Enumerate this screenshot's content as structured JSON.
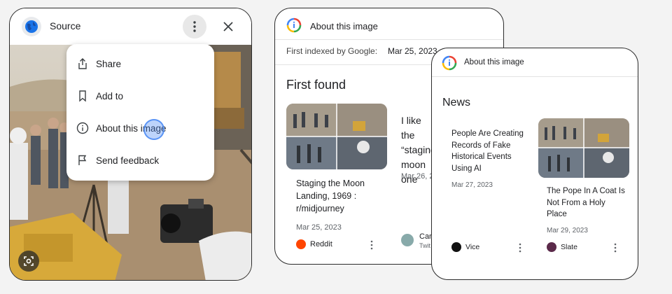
{
  "source_panel": {
    "title": "Source",
    "menu": {
      "items": [
        {
          "label": "Share",
          "icon": "share-icon"
        },
        {
          "label": "Add to",
          "icon": "bookmark-icon"
        },
        {
          "label": "About this image",
          "icon": "info-icon"
        },
        {
          "label": "Send feedback",
          "icon": "flag-icon"
        }
      ]
    },
    "icons": {
      "site": "globe-icon",
      "more": "more-vert-icon",
      "close": "close-icon",
      "lens": "lens-icon"
    }
  },
  "about_panel": {
    "title": "About this image",
    "indexed_label": "First indexed by Google:",
    "indexed_date": "Mar 25, 2023",
    "section_title": "First found",
    "results": [
      {
        "title": "Staging the Moon Landing, 1969 : r/midjourney",
        "date": "Mar 25, 2023",
        "source": "Reddit",
        "source_color": "#ff4500"
      },
      {
        "title": "I like the “staging moon one",
        "date": "Mar 26, 2",
        "source": "Carl",
        "source_sub": "Twit"
      }
    ]
  },
  "news_panel": {
    "title": "About this image",
    "section_title": "News",
    "articles": [
      {
        "title": "People Are Creating Records of Fake Historical Events Using AI",
        "date": "Mar 27, 2023",
        "source": "Vice",
        "source_color": "#111111"
      },
      {
        "title": "The Pope In A Coat Is Not From a Holy Place",
        "date": "Mar 29, 2023",
        "source": "Slate",
        "source_color": "#5b2a4a"
      }
    ]
  },
  "colors": {
    "accent": "#4285f4",
    "border": "#2b2b2b",
    "menu_highlight": "#4285f4"
  }
}
